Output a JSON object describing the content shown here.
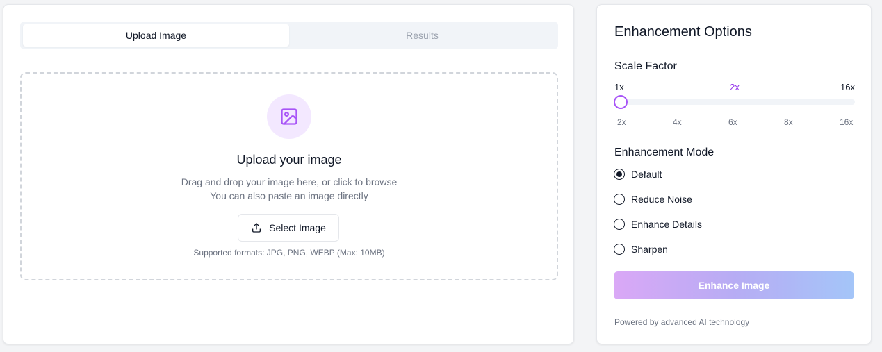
{
  "tabs": {
    "upload_label": "Upload Image",
    "results_label": "Results"
  },
  "upload": {
    "icon": "image-icon",
    "title": "Upload your image",
    "line1": "Drag and drop your image here, or click to browse",
    "line2": "You can also paste an image directly",
    "button_label": "Select Image",
    "button_icon": "upload-icon",
    "formats": "Supported formats: JPG, PNG, WEBP (Max: 10MB)"
  },
  "options": {
    "title": "Enhancement Options",
    "scale": {
      "title": "Scale Factor",
      "min_label": "1x",
      "current_label": "2x",
      "max_label": "16x",
      "value": 1,
      "ticks": [
        "2x",
        "4x",
        "6x",
        "8x",
        "16x"
      ]
    },
    "mode": {
      "title": "Enhancement Mode",
      "selected": "Default",
      "options": [
        "Default",
        "Reduce Noise",
        "Enhance Details",
        "Sharpen"
      ]
    },
    "enhance_button": "Enhance Image",
    "powered_by": "Powered by advanced AI technology"
  },
  "colors": {
    "accent": "#a855f7",
    "accent_text": "#9333ea",
    "button_gradient_start": "#d8a4f6",
    "button_gradient_end": "#9fc2f8"
  }
}
